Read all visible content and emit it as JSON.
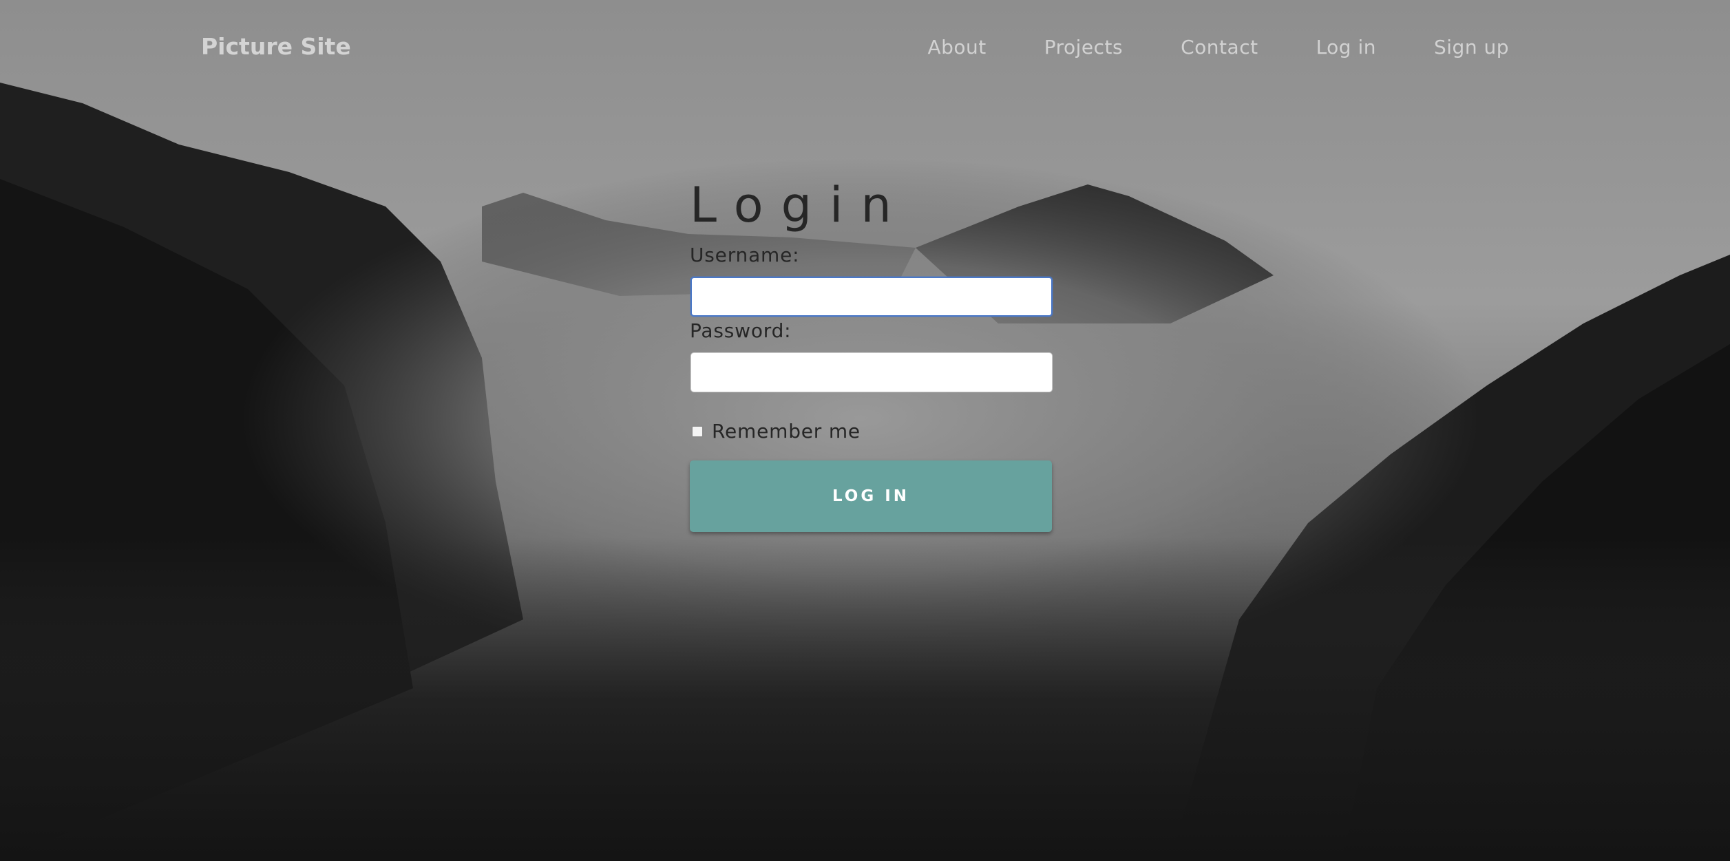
{
  "navbar": {
    "brand": "Picture Site",
    "links": [
      {
        "label": "About"
      },
      {
        "label": "Projects"
      },
      {
        "label": "Contact"
      },
      {
        "label": "Log in"
      },
      {
        "label": "Sign up"
      }
    ]
  },
  "login": {
    "title": "Login",
    "username_label": "Username:",
    "username_value": "",
    "password_label": "Password:",
    "password_value": "",
    "remember_label": "Remember me",
    "remember_checked": false,
    "submit_label": "LOG IN"
  },
  "colors": {
    "button": "#67a29e",
    "focus_ring": "#4a78c8"
  }
}
